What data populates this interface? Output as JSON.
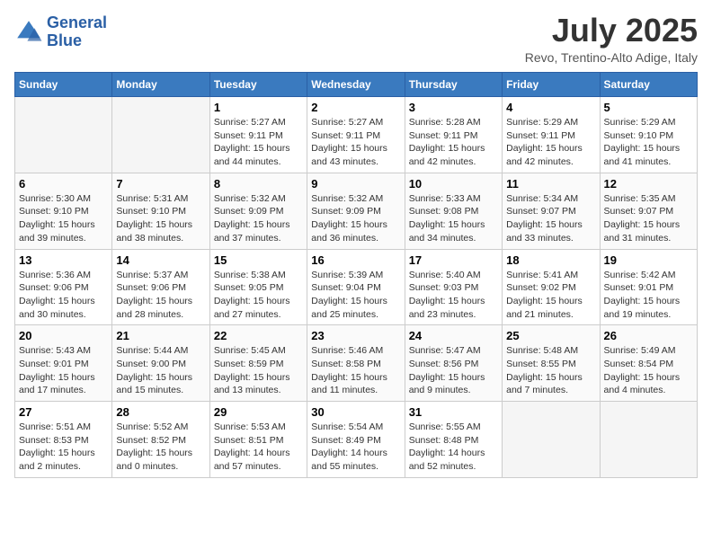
{
  "header": {
    "logo_line1": "General",
    "logo_line2": "Blue",
    "month_title": "July 2025",
    "subtitle": "Revo, Trentino-Alto Adige, Italy"
  },
  "days_of_week": [
    "Sunday",
    "Monday",
    "Tuesday",
    "Wednesday",
    "Thursday",
    "Friday",
    "Saturday"
  ],
  "weeks": [
    [
      {
        "day": "",
        "info": ""
      },
      {
        "day": "",
        "info": ""
      },
      {
        "day": "1",
        "info": "Sunrise: 5:27 AM\nSunset: 9:11 PM\nDaylight: 15 hours\nand 44 minutes."
      },
      {
        "day": "2",
        "info": "Sunrise: 5:27 AM\nSunset: 9:11 PM\nDaylight: 15 hours\nand 43 minutes."
      },
      {
        "day": "3",
        "info": "Sunrise: 5:28 AM\nSunset: 9:11 PM\nDaylight: 15 hours\nand 42 minutes."
      },
      {
        "day": "4",
        "info": "Sunrise: 5:29 AM\nSunset: 9:11 PM\nDaylight: 15 hours\nand 42 minutes."
      },
      {
        "day": "5",
        "info": "Sunrise: 5:29 AM\nSunset: 9:10 PM\nDaylight: 15 hours\nand 41 minutes."
      }
    ],
    [
      {
        "day": "6",
        "info": "Sunrise: 5:30 AM\nSunset: 9:10 PM\nDaylight: 15 hours\nand 39 minutes."
      },
      {
        "day": "7",
        "info": "Sunrise: 5:31 AM\nSunset: 9:10 PM\nDaylight: 15 hours\nand 38 minutes."
      },
      {
        "day": "8",
        "info": "Sunrise: 5:32 AM\nSunset: 9:09 PM\nDaylight: 15 hours\nand 37 minutes."
      },
      {
        "day": "9",
        "info": "Sunrise: 5:32 AM\nSunset: 9:09 PM\nDaylight: 15 hours\nand 36 minutes."
      },
      {
        "day": "10",
        "info": "Sunrise: 5:33 AM\nSunset: 9:08 PM\nDaylight: 15 hours\nand 34 minutes."
      },
      {
        "day": "11",
        "info": "Sunrise: 5:34 AM\nSunset: 9:07 PM\nDaylight: 15 hours\nand 33 minutes."
      },
      {
        "day": "12",
        "info": "Sunrise: 5:35 AM\nSunset: 9:07 PM\nDaylight: 15 hours\nand 31 minutes."
      }
    ],
    [
      {
        "day": "13",
        "info": "Sunrise: 5:36 AM\nSunset: 9:06 PM\nDaylight: 15 hours\nand 30 minutes."
      },
      {
        "day": "14",
        "info": "Sunrise: 5:37 AM\nSunset: 9:06 PM\nDaylight: 15 hours\nand 28 minutes."
      },
      {
        "day": "15",
        "info": "Sunrise: 5:38 AM\nSunset: 9:05 PM\nDaylight: 15 hours\nand 27 minutes."
      },
      {
        "day": "16",
        "info": "Sunrise: 5:39 AM\nSunset: 9:04 PM\nDaylight: 15 hours\nand 25 minutes."
      },
      {
        "day": "17",
        "info": "Sunrise: 5:40 AM\nSunset: 9:03 PM\nDaylight: 15 hours\nand 23 minutes."
      },
      {
        "day": "18",
        "info": "Sunrise: 5:41 AM\nSunset: 9:02 PM\nDaylight: 15 hours\nand 21 minutes."
      },
      {
        "day": "19",
        "info": "Sunrise: 5:42 AM\nSunset: 9:01 PM\nDaylight: 15 hours\nand 19 minutes."
      }
    ],
    [
      {
        "day": "20",
        "info": "Sunrise: 5:43 AM\nSunset: 9:01 PM\nDaylight: 15 hours\nand 17 minutes."
      },
      {
        "day": "21",
        "info": "Sunrise: 5:44 AM\nSunset: 9:00 PM\nDaylight: 15 hours\nand 15 minutes."
      },
      {
        "day": "22",
        "info": "Sunrise: 5:45 AM\nSunset: 8:59 PM\nDaylight: 15 hours\nand 13 minutes."
      },
      {
        "day": "23",
        "info": "Sunrise: 5:46 AM\nSunset: 8:58 PM\nDaylight: 15 hours\nand 11 minutes."
      },
      {
        "day": "24",
        "info": "Sunrise: 5:47 AM\nSunset: 8:56 PM\nDaylight: 15 hours\nand 9 minutes."
      },
      {
        "day": "25",
        "info": "Sunrise: 5:48 AM\nSunset: 8:55 PM\nDaylight: 15 hours\nand 7 minutes."
      },
      {
        "day": "26",
        "info": "Sunrise: 5:49 AM\nSunset: 8:54 PM\nDaylight: 15 hours\nand 4 minutes."
      }
    ],
    [
      {
        "day": "27",
        "info": "Sunrise: 5:51 AM\nSunset: 8:53 PM\nDaylight: 15 hours\nand 2 minutes."
      },
      {
        "day": "28",
        "info": "Sunrise: 5:52 AM\nSunset: 8:52 PM\nDaylight: 15 hours\nand 0 minutes."
      },
      {
        "day": "29",
        "info": "Sunrise: 5:53 AM\nSunset: 8:51 PM\nDaylight: 14 hours\nand 57 minutes."
      },
      {
        "day": "30",
        "info": "Sunrise: 5:54 AM\nSunset: 8:49 PM\nDaylight: 14 hours\nand 55 minutes."
      },
      {
        "day": "31",
        "info": "Sunrise: 5:55 AM\nSunset: 8:48 PM\nDaylight: 14 hours\nand 52 minutes."
      },
      {
        "day": "",
        "info": ""
      },
      {
        "day": "",
        "info": ""
      }
    ]
  ]
}
